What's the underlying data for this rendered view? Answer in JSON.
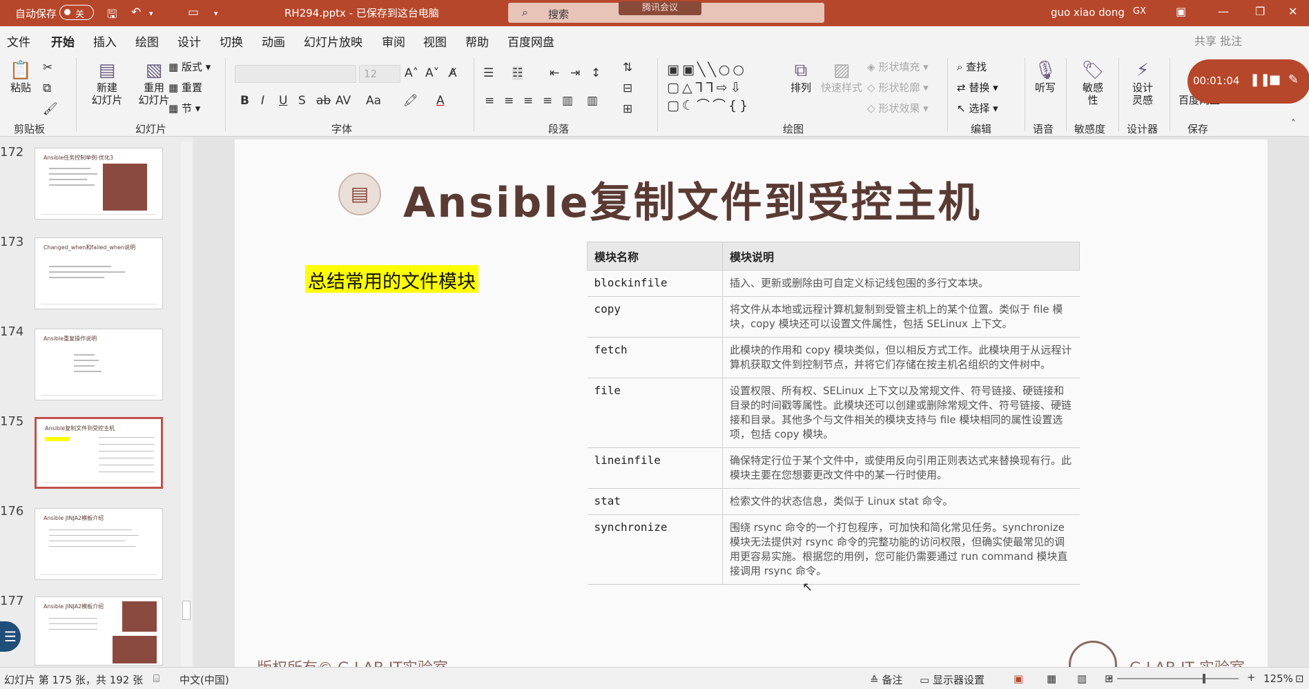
{
  "titlebar": {
    "autosave_label": "自动保存",
    "autosave_state": "关",
    "document_title": "RH294.pptx - 已保存到这台电脑",
    "search_placeholder": "搜索",
    "meeting_badge": "腾讯会议",
    "user_name": "guo xiao dong",
    "user_initials": "GX"
  },
  "menu": [
    "文件",
    "开始",
    "插入",
    "绘图",
    "设计",
    "切换",
    "动画",
    "幻灯片放映",
    "审阅",
    "视图",
    "帮助",
    "百度网盘"
  ],
  "menu_active": "开始",
  "share_label": "共享  批注",
  "ribbon": {
    "paste": "粘贴",
    "clipboard": "剪贴板",
    "new_slide_1": "新建",
    "new_slide_2": "幻灯片",
    "reuse_1": "重用",
    "reuse_2": "幻灯片",
    "layout": "版式",
    "reset": "重置",
    "section": "节",
    "slides": "幻灯片",
    "font_size": "12",
    "font": "字体",
    "paragraph": "段落",
    "arrange": "排列",
    "quick_style": "快速样式",
    "shape_fill": "形状填充",
    "shape_outline": "形状轮廓",
    "shape_effect": "形状效果",
    "drawing": "绘图",
    "find": "查找",
    "replace": "替换",
    "select": "选择",
    "editing": "编辑",
    "dictate": "听写",
    "voice": "语音",
    "sensitivity_1": "敏感",
    "sensitivity_2": "性",
    "sensitivity": "敏感度",
    "designer_1": "设计",
    "designer_2": "灵感",
    "designer": "设计器",
    "save_1": "保",
    "save_2": "百度网盘",
    "save": "保存"
  },
  "recording": {
    "time": "00:01:04"
  },
  "thumbnails": [
    {
      "num": "172",
      "title": "Ansible任务控制举例-优化3"
    },
    {
      "num": "173",
      "title": "Changed_when和failed_when说明"
    },
    {
      "num": "174",
      "title": "Ansible重复操作说明"
    },
    {
      "num": "175",
      "title": "Ansible复制文件到受控主机"
    },
    {
      "num": "176",
      "title": "Ansible JINJA2模板介绍"
    },
    {
      "num": "177",
      "title": "Ansible JINJA2模板介绍"
    }
  ],
  "slide": {
    "title": "Ansible复制文件到受控主机",
    "highlight": "总结常用的文件模块",
    "table_headers": [
      "模块名称",
      "模块说明"
    ],
    "rows": [
      {
        "name": "blockinfile",
        "desc": "插入、更新或删除由可自定义标记线包围的多行文本块。"
      },
      {
        "name": "copy",
        "desc": "将文件从本地或远程计算机复制到受管主机上的某个位置。类似于 file 模块，copy 模块还可以设置文件属性，包括 SELinux 上下文。"
      },
      {
        "name": "fetch",
        "desc": "此模块的作用和 copy 模块类似，但以相反方式工作。此模块用于从远程计算机获取文件到控制节点，并将它们存储在按主机名组织的文件树中。"
      },
      {
        "name": "file",
        "desc": "设置权限、所有权、SELinux 上下文以及常规文件、符号链接、硬链接和目录的时间戳等属性。此模块还可以创建或删除常规文件、符号链接、硬链接和目录。其他多个与文件相关的模块支持与 file 模块相同的属性设置选项，包括 copy 模块。"
      },
      {
        "name": "lineinfile",
        "desc": "确保特定行位于某个文件中，或使用反向引用正则表达式来替换现有行。此模块主要在您想要更改文件中的某一行时使用。"
      },
      {
        "name": "stat",
        "desc": "检索文件的状态信息，类似于 Linux stat 命令。"
      },
      {
        "name": "synchronize",
        "desc": "围绕 rsync 命令的一个打包程序，可加快和简化常见任务。synchronize 模块无法提供对 rsync 命令的完整功能的访问权限，但确实使最常见的调用更容易实施。根据您的用例，您可能仍需要通过 run command 模块直接调用 rsync 命令。"
      }
    ],
    "footer_left": "版权所有© G LAB IT实验室",
    "footer_right": "G LAB IT 实验室"
  },
  "status": {
    "slide_count": "幻灯片 第 175 张，共 192 张",
    "language": "中文(中国)",
    "notes": "备注",
    "display": "显示器设置",
    "zoom": "125%",
    "minus": "-",
    "plus": "+"
  },
  "colors": {
    "accent": "#b7472a",
    "title": "#5a3b34",
    "highlight": "#ffff00"
  }
}
